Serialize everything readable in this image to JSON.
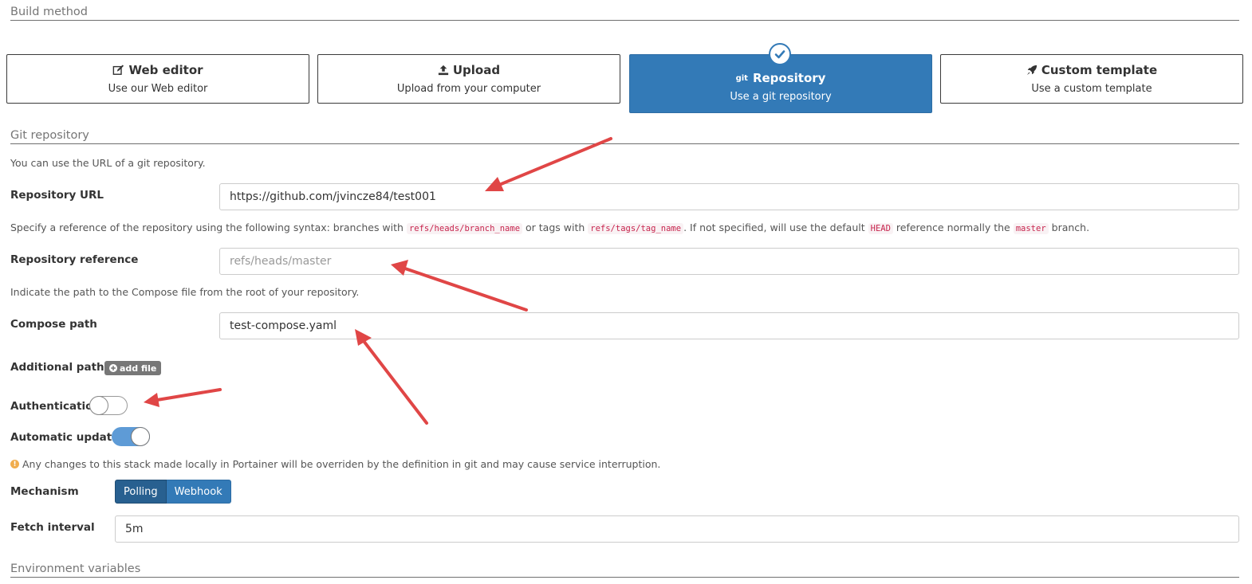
{
  "build_method": {
    "section_title": "Build method",
    "options": [
      {
        "title": "Web editor",
        "description": "Use our Web editor"
      },
      {
        "title": "Upload",
        "description": "Upload from your computer"
      },
      {
        "title": "Repository",
        "description": "Use a git repository",
        "icon_text": "git"
      },
      {
        "title": "Custom template",
        "description": "Use a custom template"
      }
    ],
    "selected": "Repository"
  },
  "git_repository": {
    "section_title": "Git repository",
    "url_help": "You can use the URL of a git repository.",
    "url_label": "Repository URL",
    "url_value": "https://github.com/jvincze84/test001",
    "reference_help": {
      "part1": "Specify a reference of the repository using the following syntax: branches with",
      "code1": "refs/heads/branch_name",
      "part2": "or tags with",
      "code2": "refs/tags/tag_name",
      "part3": ". If not specified, will use the default",
      "code3": "HEAD",
      "part4": "reference normally the",
      "code4": "master",
      "part5": "branch."
    },
    "reference_label": "Repository reference",
    "reference_placeholder": "refs/heads/master",
    "compose_help": "Indicate the path to the Compose file from the root of your repository.",
    "compose_label": "Compose path",
    "compose_value": "test-compose.yaml",
    "additional_paths_label": "Additional paths",
    "add_file_label": "add file",
    "authentication_label": "Authentication",
    "authentication_enabled": false,
    "auto_updates_label": "Automatic updates",
    "auto_updates_enabled": true,
    "warning": "Any changes to this stack made locally in Portainer will be overriden by the definition in git and may cause service interruption.",
    "mechanism_label": "Mechanism",
    "mechanism_options": [
      "Polling",
      "Webhook"
    ],
    "mechanism_selected": "Polling",
    "fetch_interval_label": "Fetch interval",
    "fetch_interval_value": "5m"
  },
  "environment": {
    "section_title": "Environment variables"
  },
  "colors": {
    "primary": "#337ab7",
    "primary_active": "#286090",
    "warning": "#f0ad4e",
    "annotation_arrow": "#e04646",
    "code_text": "#c7254e"
  }
}
